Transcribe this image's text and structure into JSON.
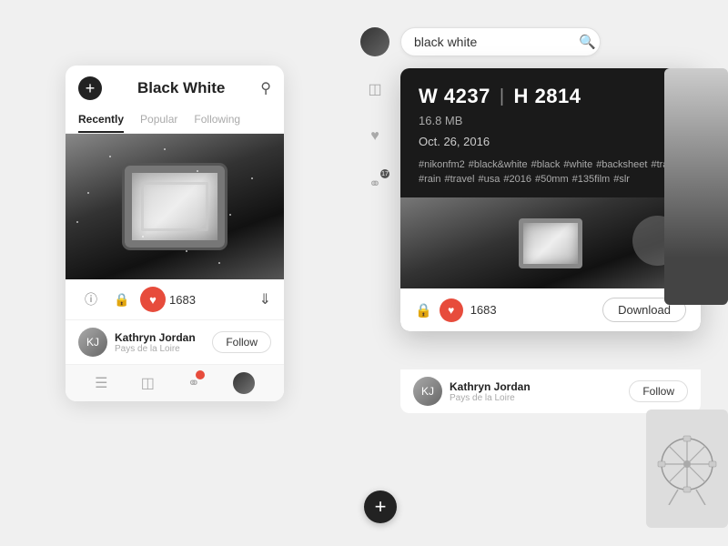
{
  "app": {
    "title": "Black White",
    "search_placeholder": "black white",
    "tabs": [
      {
        "label": "Recently",
        "active": true
      },
      {
        "label": "Popular",
        "active": false
      },
      {
        "label": "Following",
        "active": false
      }
    ]
  },
  "photo": {
    "like_count": "1683",
    "photographer": "Kathryn Jordan",
    "location": "Pays de la Loire",
    "follow_label": "Follow",
    "download_label": "Download"
  },
  "info_card": {
    "width_label": "W",
    "width_value": "4237",
    "height_label": "H",
    "height_value": "2814",
    "separator": "|",
    "filesize": "16.8 MB",
    "date": "Oct. 26, 2016",
    "tags": [
      "#nikonfm2",
      "#black&white",
      "#black",
      "#white",
      "#backsheet",
      "#train",
      "#rain",
      "#travel",
      "#usa",
      "#2016",
      "#50mm",
      "#135film",
      "#slr"
    ]
  },
  "icons": {
    "info": "ℹ",
    "lock": "🔒",
    "heart": "♥",
    "download": "⬇",
    "comment": "💬",
    "search": "🔍",
    "chat": "💬",
    "plus": "+",
    "person": "👤"
  }
}
